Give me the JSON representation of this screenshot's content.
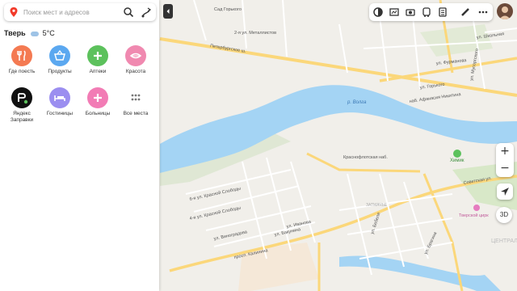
{
  "search": {
    "placeholder": "Поиск мест и адресов"
  },
  "weather": {
    "city": "Тверь",
    "temp": "5°C"
  },
  "categories": [
    {
      "label": "Где поесть",
      "color": "#f47a52"
    },
    {
      "label": "Продукты",
      "color": "#5ba8f0"
    },
    {
      "label": "Аптеки",
      "color": "#5cc15c"
    },
    {
      "label": "Красота",
      "color": "#f089b0"
    },
    {
      "label": "Яндекс\nЗаправки",
      "color": "#111111"
    },
    {
      "label": "Гостиницы",
      "color": "#9b8ef0"
    },
    {
      "label": "Больницы",
      "color": "#f27cb5"
    },
    {
      "label": "Все места",
      "color": "#ffffff"
    }
  ],
  "map_controls": {
    "zoom_in": "+",
    "zoom_out": "−",
    "mode_3d": "3D"
  },
  "map_labels": {
    "river": "р. Волга",
    "petersburg": "Петербургское ш.",
    "gorkogo": "ул. Горького",
    "nikitina": "наб. Афанасия Никитина",
    "krasnoflot": "Краснофлотская наб.",
    "sovetskaya": "Советская ул.",
    "kalinina": "просп. Калинина",
    "himik": "Химик",
    "circus": "Тверской цирк",
    "sad": "Сад Горького",
    "metallistov": "2-я ул. Металлистов",
    "furmanova": "ул. Фурманова",
    "shkolnaya": "ул. Школьная",
    "musorgskogo": "ул. Мусоргского",
    "slobodka1": "6-я ул. Красной Слободы",
    "slobodka2": "4-я ул. Красной Слободы",
    "vinogradova": "ул. Виноградова",
    "ivanova": "ул. Иванова",
    "bakunina": "ул. Бакунина",
    "bebelya": "ул. Бебеля",
    "brailya": "ул. Брагина",
    "centr": "ЦЕНТРАЛЬНЫЙ РАЙОН",
    "zatmache": "ЗАТМАЧЬЕ"
  }
}
